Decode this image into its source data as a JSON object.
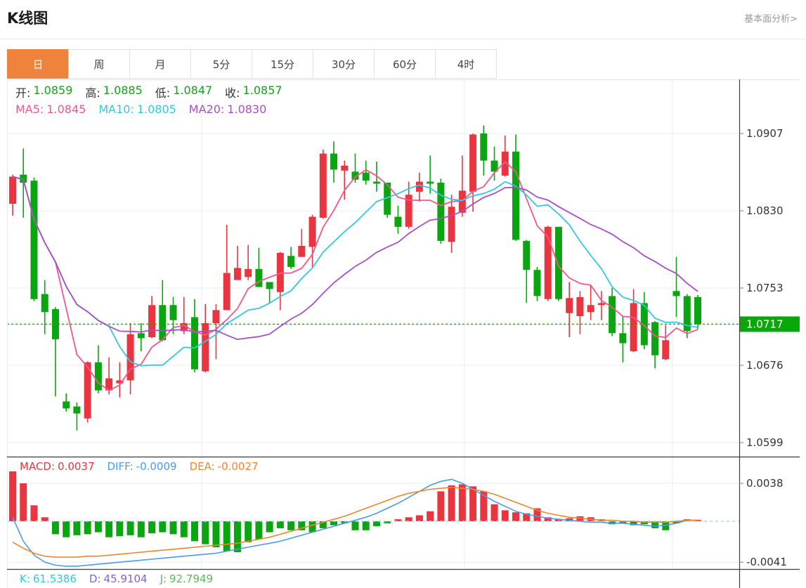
{
  "header": {
    "title": "K线图",
    "link": "基本面分析>"
  },
  "tabs": {
    "items": [
      {
        "id": "day",
        "label": "日",
        "active": true
      },
      {
        "id": "week",
        "label": "周",
        "active": false
      },
      {
        "id": "month",
        "label": "月",
        "active": false
      },
      {
        "id": "5min",
        "label": "5分",
        "active": false
      },
      {
        "id": "15min",
        "label": "15分",
        "active": false
      },
      {
        "id": "30min",
        "label": "30分",
        "active": false
      },
      {
        "id": "60min",
        "label": "60分",
        "active": false
      },
      {
        "id": "4hour",
        "label": "4时",
        "active": false
      }
    ]
  },
  "legend": {
    "ohlc_row": [
      {
        "name": "open",
        "label": "开:",
        "value": "1.0859",
        "label_color": "#333333",
        "value_color": "#15a01e"
      },
      {
        "name": "high",
        "label": "高:",
        "value": "1.0885",
        "label_color": "#333333",
        "value_color": "#15a01e"
      },
      {
        "name": "low",
        "label": "低:",
        "value": "1.0847",
        "label_color": "#333333",
        "value_color": "#15a01e"
      },
      {
        "name": "close",
        "label": "收:",
        "value": "1.0857",
        "label_color": "#333333",
        "value_color": "#15a01e"
      }
    ],
    "ma_row": [
      {
        "name": "ma5",
        "label": "MA5:",
        "value": "1.0845",
        "color": "#f4558c"
      },
      {
        "name": "ma10",
        "label": "MA10:",
        "value": "1.0805",
        "color": "#35c6e0"
      },
      {
        "name": "ma20",
        "label": "MA20:",
        "value": "1.0830",
        "color": "#a84fc5"
      }
    ],
    "macd_row": [
      {
        "name": "macd",
        "label": "MACD:",
        "value": "0.0037",
        "color": "#e9353f"
      },
      {
        "name": "diff",
        "label": "DIFF:",
        "value": "-0.0009",
        "color": "#4a9bea"
      },
      {
        "name": "dea",
        "label": "DEA:",
        "value": "-0.0027",
        "color": "#f0852c"
      }
    ],
    "kdj_row": [
      {
        "name": "k",
        "label": "K:",
        "value": "61.5386",
        "color": "#2ec8e0"
      },
      {
        "name": "d",
        "label": "D:",
        "value": "45.9104",
        "color": "#8163d4"
      },
      {
        "name": "j",
        "label": "J:",
        "value": "92.7949",
        "color": "#5cb85c"
      }
    ]
  },
  "colors": {
    "up": "#e9353f",
    "down": "#0ba511",
    "ma5": "#f4558c",
    "ma10": "#35c6e0",
    "ma20": "#a84fc5",
    "diff": "#4a9bea",
    "dea": "#f0852c",
    "price_line": "#0fa818",
    "price_tag_bg": "#0aa70a",
    "zero_line": "#a9d7f5",
    "grid": "#e7eef5",
    "axis": "#3c3c3c",
    "tick_text": "#333333",
    "accent": "#ef823d"
  },
  "chart_data": {
    "type": "candlestick",
    "title": "K线图",
    "grid": true,
    "main_pane": {
      "y_ticks": [
        1.0907,
        1.083,
        1.0753,
        1.0676,
        1.0599
      ],
      "current_price": 1.0717,
      "ma_periods": [
        5,
        10,
        20
      ],
      "candles": [
        [
          1.0837,
          1.0866,
          1.0825,
          1.0864
        ],
        [
          1.0866,
          1.0892,
          1.0823,
          1.0858
        ],
        [
          1.086,
          1.0863,
          1.074,
          1.0742
        ],
        [
          1.0747,
          1.0761,
          1.0707,
          1.0729
        ],
        [
          1.0732,
          1.0734,
          1.0645,
          1.0702
        ],
        [
          1.064,
          1.0648,
          1.063,
          1.0633
        ],
        [
          1.0635,
          1.0639,
          1.0611,
          1.0628
        ],
        [
          1.0623,
          1.068,
          1.0619,
          1.0679
        ],
        [
          1.0679,
          1.0696,
          1.0648,
          1.0651
        ],
        [
          1.0651,
          1.0684,
          1.0647,
          1.0663
        ],
        [
          1.0658,
          1.0679,
          1.0644,
          1.0661
        ],
        [
          1.0661,
          1.0718,
          1.0647,
          1.0707
        ],
        [
          1.0708,
          1.0718,
          1.069,
          1.0703
        ],
        [
          1.0704,
          1.0745,
          1.0703,
          1.0736
        ],
        [
          1.0736,
          1.0761,
          1.07,
          1.0701
        ],
        [
          1.0736,
          1.0744,
          1.0707,
          1.0721
        ],
        [
          1.071,
          1.0744,
          1.0707,
          1.0718
        ],
        [
          1.0724,
          1.0742,
          1.0669,
          1.0672
        ],
        [
          1.067,
          1.0737,
          1.0669,
          1.0718
        ],
        [
          1.0718,
          1.0737,
          1.0682,
          1.0731
        ],
        [
          1.0731,
          1.0816,
          1.0731,
          1.0768
        ],
        [
          1.0761,
          1.0795,
          1.0761,
          1.0773
        ],
        [
          1.0764,
          1.0796,
          1.0761,
          1.0772
        ],
        [
          1.0772,
          1.0793,
          1.0754,
          1.0754
        ],
        [
          1.0759,
          1.0759,
          1.0738,
          1.0752
        ],
        [
          1.0749,
          1.0789,
          1.0731,
          1.0788
        ],
        [
          1.0785,
          1.0794,
          1.0772,
          1.0774
        ],
        [
          1.0784,
          1.0812,
          1.0784,
          1.0795
        ],
        [
          1.0794,
          1.0826,
          1.0774,
          1.0824
        ],
        [
          1.0823,
          1.0891,
          1.0822,
          1.0887
        ],
        [
          1.0887,
          1.0899,
          1.0858,
          1.0871
        ],
        [
          1.087,
          1.088,
          1.0841,
          1.0875
        ],
        [
          1.0869,
          1.0887,
          1.0858,
          1.0861
        ],
        [
          1.0868,
          1.088,
          1.0856,
          1.086
        ],
        [
          1.0859,
          1.0879,
          1.0849,
          1.0857
        ],
        [
          1.0858,
          1.0858,
          1.0823,
          1.0826
        ],
        [
          1.0824,
          1.0835,
          1.0807,
          1.0814
        ],
        [
          1.0814,
          1.0859,
          1.0812,
          1.0846
        ],
        [
          1.0849,
          1.0868,
          1.0839,
          1.0859
        ],
        [
          1.0859,
          1.0885,
          1.0847,
          1.0857
        ],
        [
          1.0858,
          1.0862,
          1.0797,
          1.08
        ],
        [
          1.0799,
          1.0846,
          1.0788,
          1.0834
        ],
        [
          1.0828,
          1.0885,
          1.0824,
          1.085
        ],
        [
          1.0849,
          1.0907,
          1.0829,
          1.0906
        ],
        [
          1.0907,
          1.0915,
          1.0865,
          1.088
        ],
        [
          1.088,
          1.0894,
          1.086,
          1.0869
        ],
        [
          1.0865,
          1.0905,
          1.0864,
          1.0889
        ],
        [
          1.0889,
          1.0906,
          1.08,
          1.0801
        ],
        [
          1.08,
          1.0801,
          1.0738,
          1.0771
        ],
        [
          1.0771,
          1.0774,
          1.074,
          1.0745
        ],
        [
          1.0742,
          1.0815,
          1.074,
          1.0814
        ],
        [
          1.0814,
          1.0814,
          1.074,
          1.0742
        ],
        [
          1.0728,
          1.0759,
          1.0704,
          1.0743
        ],
        [
          1.0725,
          1.075,
          1.0707,
          1.0744
        ],
        [
          1.0729,
          1.0756,
          1.0721,
          1.0736
        ],
        [
          1.0736,
          1.075,
          1.0721,
          1.0738
        ],
        [
          1.0745,
          1.0753,
          1.0705,
          1.0708
        ],
        [
          1.0708,
          1.0725,
          1.0679,
          1.0698
        ],
        [
          1.069,
          1.0752,
          1.0689,
          1.0738
        ],
        [
          1.0738,
          1.0749,
          1.0692,
          1.0696
        ],
        [
          1.0719,
          1.072,
          1.0673,
          1.0686
        ],
        [
          1.0682,
          1.0716,
          1.0681,
          1.0701
        ],
        [
          1.075,
          1.0784,
          1.0724,
          1.0745
        ],
        [
          1.0745,
          1.0747,
          1.0703,
          1.071
        ],
        [
          1.0744,
          1.0746,
          1.0712,
          1.0717
        ]
      ]
    },
    "macd_pane": {
      "y_ticks": [
        0.0038,
        -0.0041
      ],
      "unit": 0.0001,
      "hist": [
        50,
        38,
        16,
        4,
        -13,
        -16,
        -14,
        -13,
        -11,
        -16,
        -15,
        -14,
        -16,
        -12,
        -11,
        -13,
        -16,
        -20,
        -23,
        -26,
        -30,
        -31,
        -21,
        -18,
        -11,
        -7,
        -9,
        -9,
        -11,
        -7,
        -4,
        -2,
        -9,
        -9,
        -5,
        -2,
        2,
        4,
        6,
        10,
        30,
        36,
        37,
        35,
        30,
        17,
        11,
        9,
        8,
        13,
        4,
        2,
        3,
        5,
        4,
        2,
        -3,
        -2,
        -4,
        -3,
        -7,
        -9,
        -2,
        2,
        1
      ],
      "diff": [
        4,
        -20,
        -34,
        -41,
        -44,
        -45,
        -45,
        -44,
        -43,
        -42,
        -41,
        -40,
        -39,
        -38,
        -37,
        -36,
        -35,
        -34,
        -33,
        -32,
        -30,
        -28,
        -26,
        -24,
        -22,
        -20,
        -17,
        -14,
        -11,
        -8,
        -5,
        -2,
        1,
        4,
        8,
        13,
        18,
        24,
        30,
        36,
        40,
        42,
        38,
        32,
        26,
        20,
        15,
        10,
        7,
        5,
        3,
        2,
        1,
        0,
        -1,
        -1,
        -2,
        -2,
        -3,
        -4,
        -5,
        -4,
        -2,
        1,
        1
      ],
      "dea": [
        -21,
        -27,
        -32,
        -35,
        -36,
        -36,
        -36,
        -35,
        -35,
        -34,
        -33,
        -32,
        -31,
        -30,
        -29,
        -28,
        -27,
        -26,
        -25,
        -24,
        -23,
        -22,
        -20,
        -18,
        -16,
        -13,
        -10,
        -7,
        -4,
        -1,
        2,
        5,
        9,
        13,
        17,
        21,
        25,
        28,
        30,
        32,
        33,
        34,
        33,
        32,
        30,
        27,
        23,
        19,
        15,
        11,
        8,
        6,
        4,
        3,
        2,
        1,
        1,
        0,
        0,
        -1,
        -1,
        -1,
        0,
        1,
        1
      ]
    },
    "kdj_pane": {
      "k": 61.5386,
      "d": 45.9104,
      "j": 92.7949
    }
  }
}
